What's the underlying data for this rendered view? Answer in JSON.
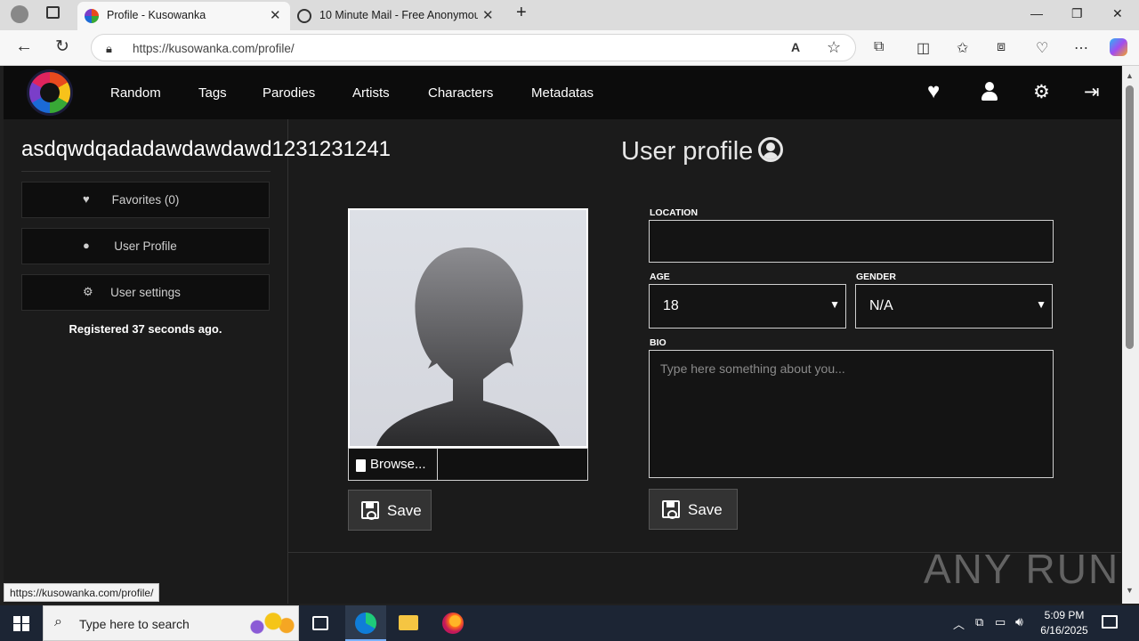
{
  "browser": {
    "tabs": [
      {
        "title": "Profile - Kusowanka",
        "active": true
      },
      {
        "title": "10 Minute Mail - Free Anonymous",
        "active": false
      }
    ],
    "url": "https://kusowanka.com/profile/"
  },
  "navbar": {
    "items": [
      "Random",
      "Tags",
      "Parodies",
      "Artists",
      "Characters",
      "Metadatas"
    ],
    "icons": [
      "heart-icon",
      "user-icon",
      "gear-icon",
      "logout-icon"
    ]
  },
  "sidebar": {
    "username": "asdqwdqadadawdawdawd1231231241",
    "buttons": [
      {
        "label": "Favorites (0)",
        "icon": "heart-icon"
      },
      {
        "label": "User Profile",
        "icon": "user-icon"
      },
      {
        "label": "User settings",
        "icon": "gear-icon"
      }
    ],
    "registered": "Registered 37 seconds ago."
  },
  "profile": {
    "title": "User profile",
    "browse_label": "Browse...",
    "save_label": "Save",
    "location_label": "LOCATION",
    "location_value": "",
    "age_label": "AGE",
    "age_value": "18",
    "gender_label": "GENDER",
    "gender_value": "N/A",
    "bio_label": "BIO",
    "bio_placeholder": "Type here something about you..."
  },
  "status_url": "https://kusowanka.com/profile/",
  "watermark": "ANY RUN",
  "taskbar": {
    "search_placeholder": "Type here to search",
    "time": "5:09 PM",
    "date": "6/16/2025"
  }
}
